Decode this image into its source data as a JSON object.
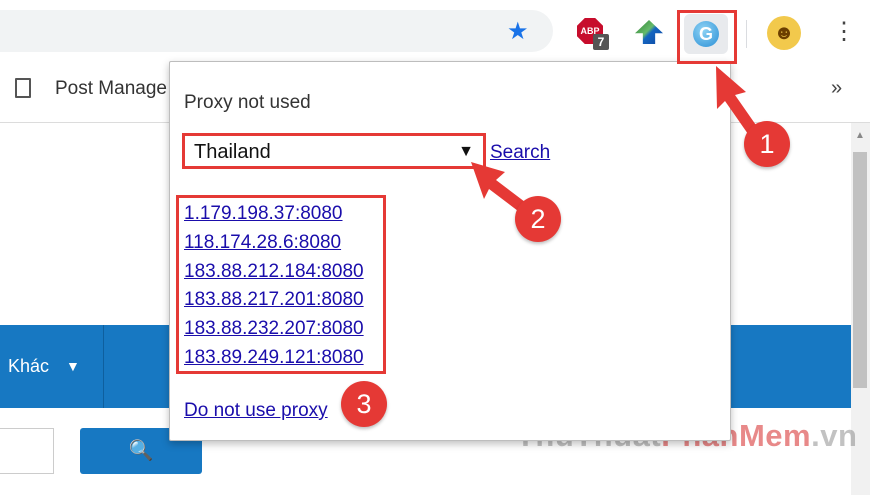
{
  "toolbar": {
    "extensions": [
      {
        "name": "adblock",
        "icon": "stop-icon",
        "label": "ABP",
        "count": "7"
      },
      {
        "name": "internet-download-manager",
        "icon": "download-arrow-icon"
      },
      {
        "name": "proxy-switcher",
        "icon": "g-globe-icon",
        "label": "G"
      }
    ],
    "bookmark_icon": "star-icon",
    "menu_icon": "kebab-icon"
  },
  "bookmarks": {
    "items": [
      {
        "label": "Post Manage",
        "icon": "document-icon"
      }
    ],
    "overflow_label": "»"
  },
  "page": {
    "nav_label": "Khác",
    "nav_caret": "▼",
    "search_icon": "magnifier-icon",
    "search_glyph": "🔍"
  },
  "popup": {
    "status": "Proxy not used",
    "country_selected": "Thailand",
    "select_caret": "▼",
    "search_link": "Search",
    "proxies": [
      "1.179.198.37:8080",
      "118.174.28.6:8080",
      "183.88.212.184:8080",
      "183.88.217.201:8080",
      "183.88.232.207:8080",
      "183.89.249.121:8080"
    ],
    "disable_link": "Do not use proxy"
  },
  "callouts": [
    "1",
    "2",
    "3"
  ],
  "watermark": {
    "part1": "ThuThuat",
    "part2": "PhanMem",
    "part3": ".vn"
  },
  "colors": {
    "accent_red": "#e53935",
    "nav_blue": "#1778c2",
    "link": "#1a0dab",
    "chrome_blue_star": "#1a73e8"
  }
}
